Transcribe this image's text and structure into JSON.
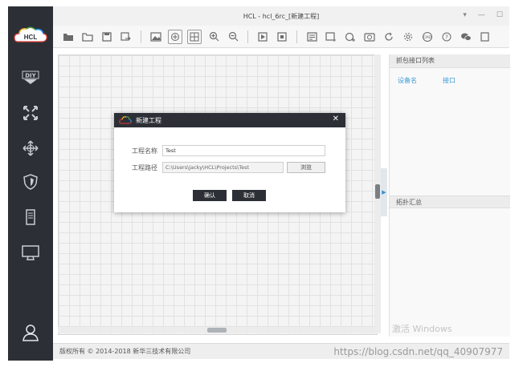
{
  "window": {
    "title": "HCL - hcl_6rc_[新建工程]",
    "controls": [
      "▾",
      "—",
      "☐"
    ]
  },
  "app_logo": {
    "text": "HCL",
    "colors": [
      "#e53935",
      "#fbc02d",
      "#43a047",
      "#1e88e5"
    ]
  },
  "sidebar": {
    "items": [
      {
        "icon": "diy-icon",
        "glyph": "DIY"
      },
      {
        "icon": "router-icon",
        "glyph": "✖"
      },
      {
        "icon": "switch-icon",
        "glyph": "✥"
      },
      {
        "icon": "firewall-icon",
        "glyph": "⛨"
      },
      {
        "icon": "server-icon",
        "glyph": "▤"
      },
      {
        "icon": "terminal-icon",
        "glyph": "▭"
      }
    ],
    "user_icon": "user-icon"
  },
  "right_panel": {
    "section1": "抓包接口列表",
    "col1": "设备名",
    "col2": "接口",
    "section2": "拓扑汇总"
  },
  "footer": {
    "copyright": "版权所有 © 2014-2018 新华三技术有限公司",
    "watermark": "https://blog.csdn.net/qq_40907977"
  },
  "os_overlay": "激活 Windows",
  "dialog": {
    "title": "新建工程",
    "close": "✕",
    "name_label": "工程名称",
    "name_value": "Test",
    "path_label": "工程路径",
    "path_value": "C:\\Users\\jacky\\HCL\\Projects\\Test",
    "browse": "浏览",
    "ok": "确认",
    "cancel": "取消"
  },
  "accent": "#2c3036"
}
